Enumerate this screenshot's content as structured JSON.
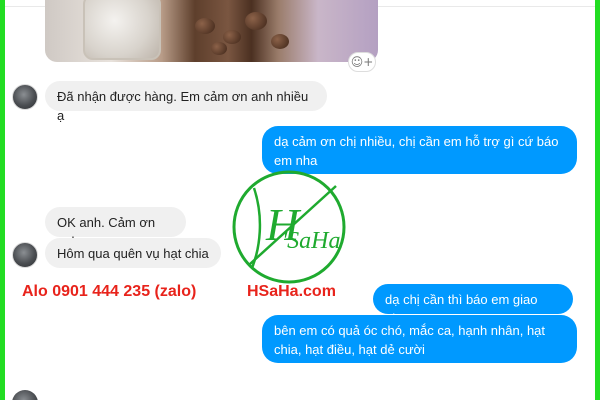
{
  "messages": {
    "received_1": "Đã nhận được hàng. Em cảm ơn anh nhiều ạ",
    "sent_1": "dạ cảm ơn chị nhiều, chị cần em hỗ trợ gì cứ báo em nha",
    "received_2": "OK anh. Cảm ơn anh",
    "received_3": "Hôm qua quên vụ hạt chia",
    "sent_2": "dạ chị cần thì báo em giao nha.",
    "sent_3": "bên em có quả óc chó, mắc ca, hạnh nhân, hạt chia, hạt điều, hạt dẻ cười"
  },
  "watermark": {
    "phone": "Alo 0901 444 235 (zalo)",
    "site": "HSaHa.com",
    "logo_text": "'SaHa",
    "logo_letter": "H"
  },
  "icons": {
    "reaction": "smiley-plus-icon"
  },
  "colors": {
    "frame": "#22dd22",
    "sent_bubble": "#0099ff",
    "received_bubble": "#f0f0f0",
    "promo_text": "#e8231b",
    "logo_green": "#1faa2f"
  }
}
